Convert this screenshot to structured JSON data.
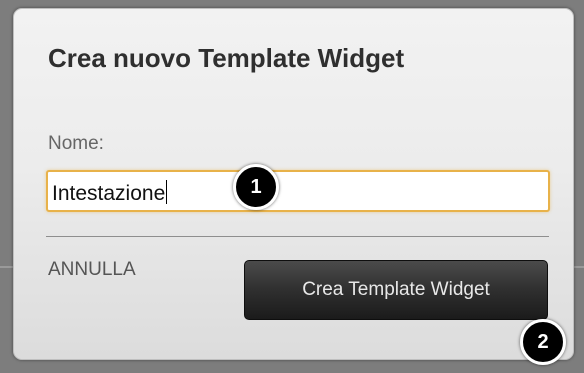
{
  "dialog": {
    "title": "Crea nuovo Template Widget",
    "name_label": "Nome:",
    "name_value": "Intestazione",
    "cancel_label": "ANNULLA",
    "create_label": "Crea Template Widget"
  },
  "markers": [
    "1",
    "2"
  ],
  "colors": {
    "input_focus_border": "#e8b24a",
    "button_background": "#2e2e2e",
    "dialog_background": "#ececec"
  }
}
